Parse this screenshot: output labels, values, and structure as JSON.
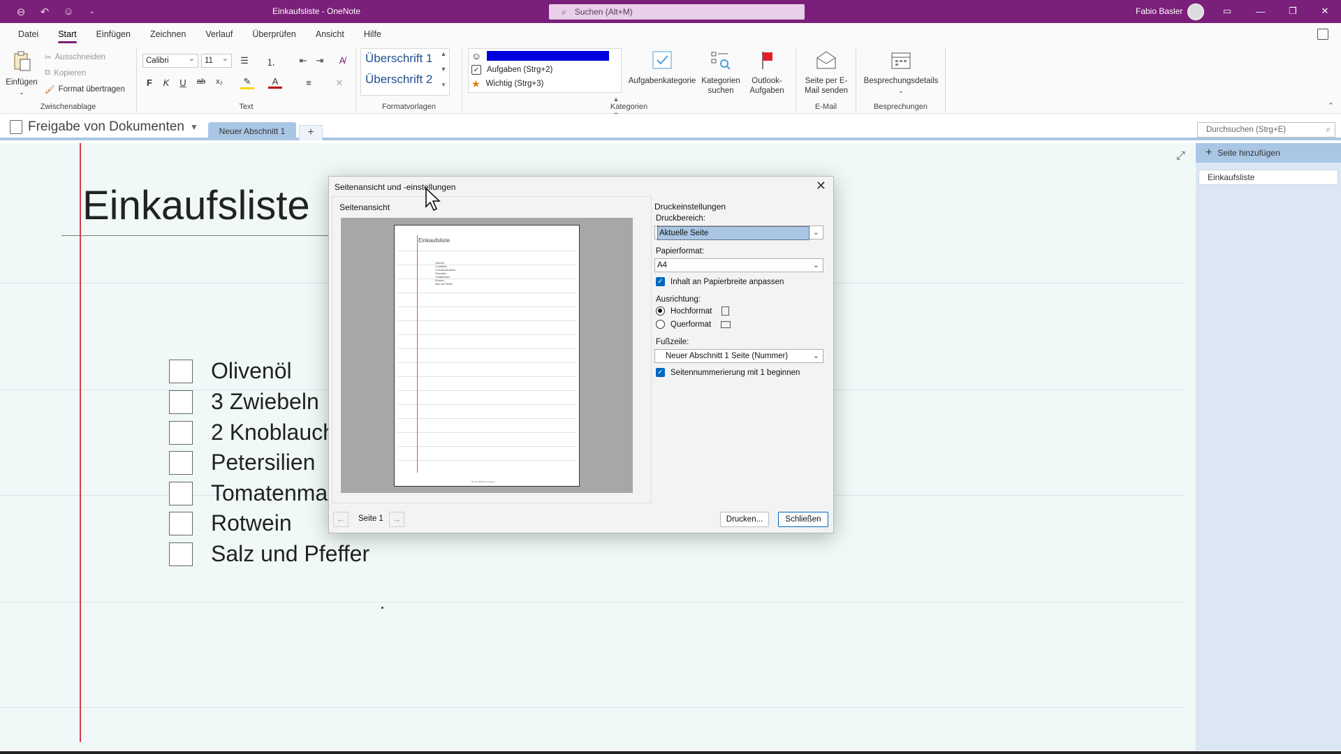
{
  "titlebar": {
    "doc_title": "Einkaufsliste  -  OneNote",
    "search_placeholder": "Suchen (Alt+M)",
    "user_name": "Fabio Basler"
  },
  "menu": {
    "items": [
      "Datei",
      "Start",
      "Einfügen",
      "Zeichnen",
      "Verlauf",
      "Überprüfen",
      "Ansicht",
      "Hilfe"
    ],
    "active": "Start"
  },
  "ribbon": {
    "clipboard": {
      "paste": "Einfügen",
      "cut": "Ausschneiden",
      "copy": "Kopieren",
      "format_painter": "Format übertragen",
      "label": "Zwischenablage"
    },
    "text": {
      "font": "Calibri",
      "size": "11",
      "bold": "F",
      "italic": "K",
      "underline": "U",
      "strike": "ab",
      "subscript": "x₂",
      "label": "Text"
    },
    "styles": {
      "h1": "Überschrift 1",
      "h2": "Überschrift 2",
      "label": "Formatvorlagen"
    },
    "tags": {
      "task": "Aufgaben (Strg+2)",
      "important": "Wichtig (Strg+3)",
      "task_category": "Aufgabenkategorie",
      "find_tags_line1": "Kategorien",
      "find_tags_line2": "suchen",
      "outlook_line1": "Outlook-",
      "outlook_line2": "Aufgaben",
      "label": "Kategorien"
    },
    "email": {
      "line1": "Seite per E-",
      "line2": "Mail senden",
      "label": "E-Mail"
    },
    "meetings": {
      "details": "Besprechungsdetails",
      "label": "Besprechungen"
    }
  },
  "notebook": {
    "name": "Freigabe von Dokumenten",
    "section": "Neuer Abschnitt 1",
    "add_section": "+",
    "search_placeholder": "Durchsuchen (Strg+E)"
  },
  "pages": {
    "add_page": "Seite hinzufügen",
    "items": [
      "Einkaufsliste"
    ]
  },
  "note": {
    "title": "Einkaufsliste",
    "todos": [
      "Olivenöl",
      "3 Zwiebeln",
      "2 Knoblauch",
      "Petersilien",
      "Tomatenma",
      "Rotwein",
      "Salz und Pfeffer"
    ]
  },
  "dialog": {
    "title": "Seitenansicht und -einstellungen",
    "preview_label": "Seitenansicht",
    "preview_page": {
      "title": "Einkaufsliste",
      "items": [
        "Olivenöl",
        "3 Zwiebeln",
        "2 Knoblauchzehen",
        "Petersilien",
        "Tomatenmark",
        "Rotwein",
        "Salz und Pfeffer"
      ],
      "footer": "Neuer Abschnitt 1 Seite 1"
    },
    "settings_label": "Druckeinstellungen",
    "print_range_label": "Druckbereich:",
    "print_range_value": "Aktuelle Seite",
    "paper_label": "Papierformat:",
    "paper_value": "A4",
    "fit_width": "Inhalt an Papierbreite anpassen",
    "orientation_label": "Ausrichtung:",
    "portrait": "Hochformat",
    "landscape": "Querformat",
    "footer_label": "Fußzeile:",
    "footer_value": "Neuer Abschnitt 1 Seite (Nummer)",
    "start_numbering": "Seitennummerierung mit 1 beginnen",
    "page_nav": "Seite 1",
    "print_button": "Drucken...",
    "close_button": "Schließen"
  }
}
